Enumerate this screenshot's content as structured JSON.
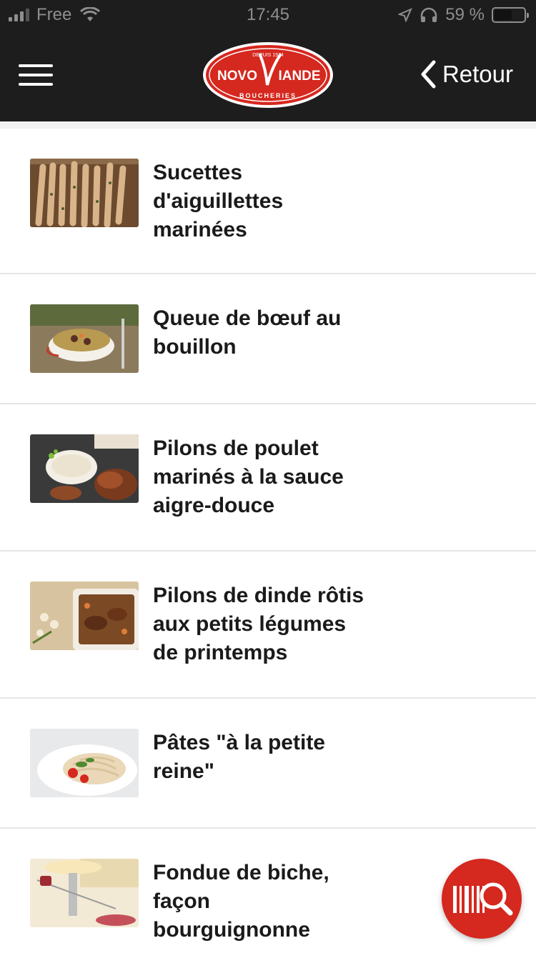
{
  "status_bar": {
    "carrier": "Free",
    "time": "17:45",
    "battery": "59 %",
    "battery_level": 0.59
  },
  "header": {
    "logo": {
      "line_top": "DEPUIS 1974",
      "brand_left": "NOVO",
      "brand_right": "IANDE",
      "line_bottom": "BOUCHERIES"
    },
    "back_label": "Retour",
    "colors": {
      "bar": "#1d1d1d",
      "brand_red": "#d5281f"
    }
  },
  "recipes": [
    {
      "title_lines": [
        "Sucettes",
        "d'aiguillettes",
        "marinées"
      ]
    },
    {
      "title_lines": [
        "Queue de bœuf au",
        "bouillon"
      ]
    },
    {
      "title_lines": [
        "Pilons de poulet",
        "marinés à la sauce",
        "aigre-douce"
      ]
    },
    {
      "title_lines": [
        "Pilons de dinde rôtis",
        "aux petits légumes",
        "de printemps"
      ]
    },
    {
      "title_lines": [
        "Pâtes \"à la petite",
        "reine\""
      ]
    },
    {
      "title_lines": [
        "Fondue de biche,",
        "façon",
        "bourguignonne"
      ]
    }
  ],
  "fab": {
    "icon": "barcode-search-icon"
  }
}
